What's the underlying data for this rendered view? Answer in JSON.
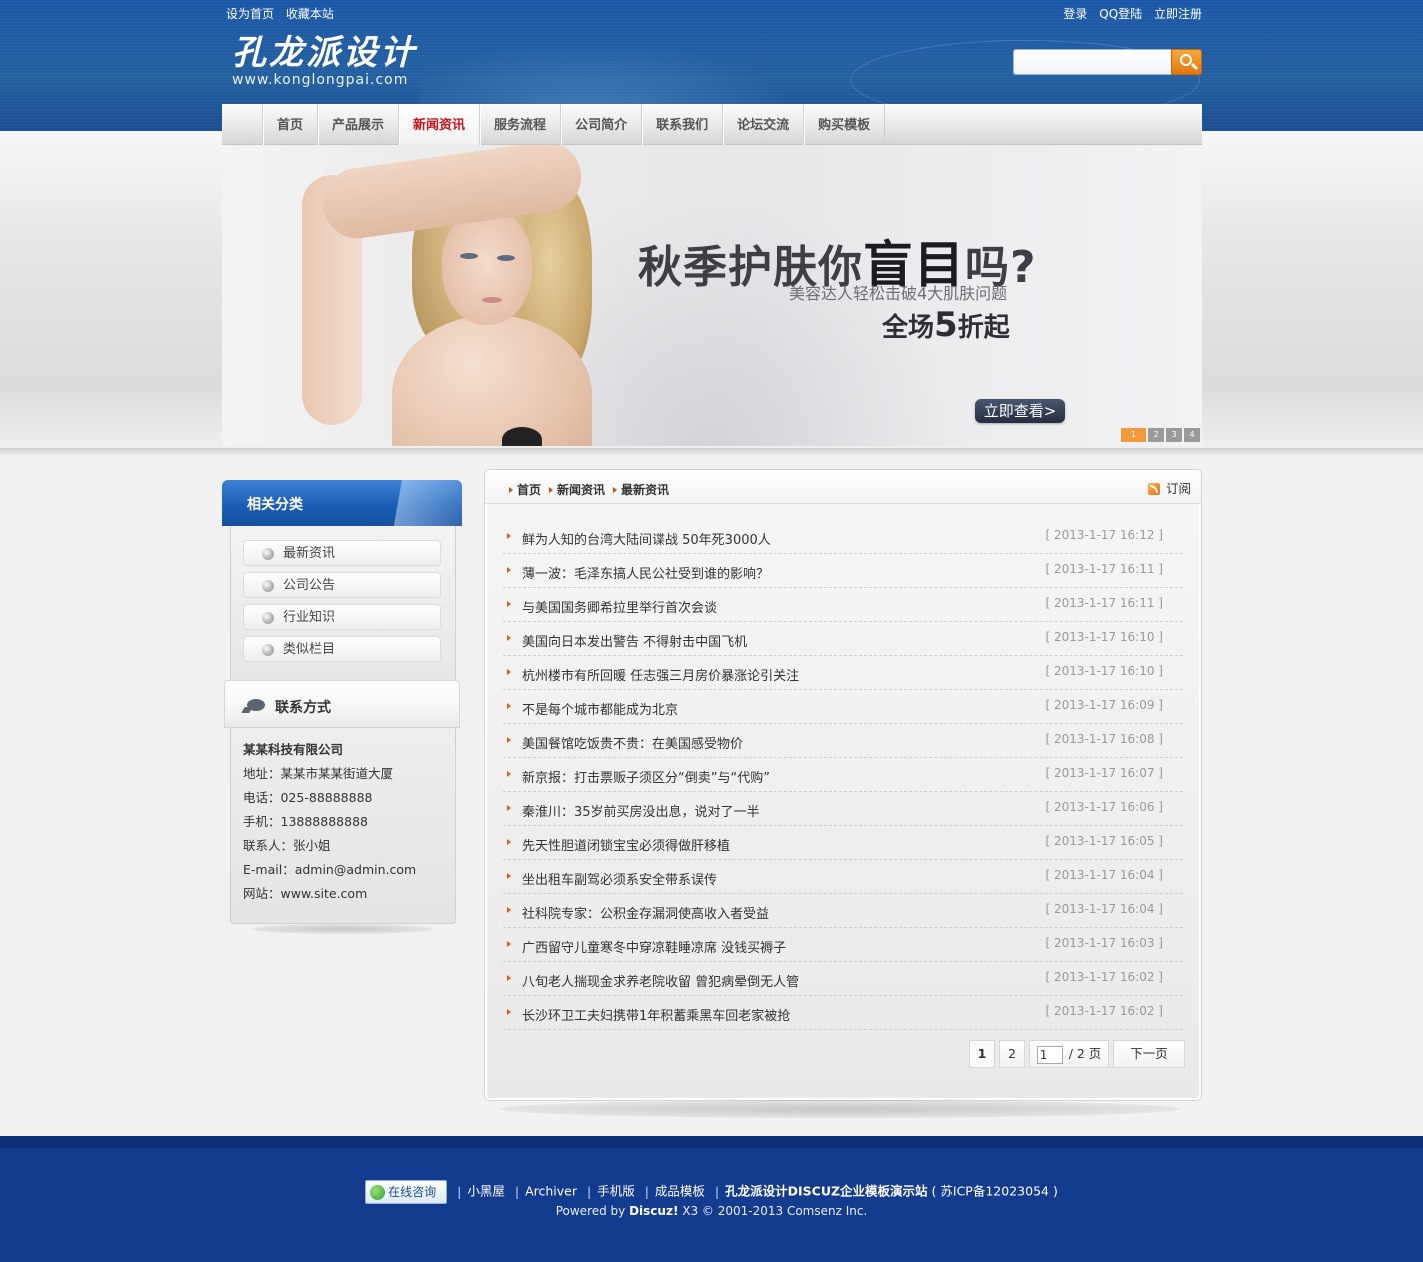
{
  "topbar": {
    "left": [
      "设为首页",
      "收藏本站"
    ],
    "right": [
      "登录",
      "QQ登陆",
      "立即注册"
    ]
  },
  "logo": {
    "title": "孔龙派设计",
    "url": "www.konglongpai.com"
  },
  "search": {
    "placeholder": "",
    "value": ""
  },
  "nav": {
    "items": [
      "首页",
      "产品展示",
      "新闻资讯",
      "服务流程",
      "公司简介",
      "联系我们",
      "论坛交流",
      "购买模板"
    ],
    "active": "新闻资讯"
  },
  "banner": {
    "headline_a": "秋季护肤你",
    "headline_b": "盲目",
    "headline_c": "吗?",
    "sub": "美容达人轻松击破4大肌肤问题",
    "promo_a": "全场",
    "promo_b": "5",
    "promo_c": "折起",
    "button": "立即查看>",
    "dots": [
      "1",
      "2",
      "3",
      "4"
    ],
    "active_dot": 1
  },
  "sidebar": {
    "category_title": "相关分类",
    "categories": [
      "最新资讯",
      "公司公告",
      "行业知识",
      "类似栏目"
    ],
    "contact_title": "联系方式",
    "contact": {
      "company": "某某科技有限公司",
      "address": "地址：某某市某某街道大厦",
      "phone": "电话：025-88888888",
      "mobile": "手机：13888888888",
      "person": "联系人：张小姐",
      "email": "E-mail：admin@admin.com",
      "site": "网站：www.site.com"
    }
  },
  "breadcrumb": [
    "首页",
    "新闻资讯",
    "最新资讯"
  ],
  "rss_label": "订阅",
  "news": [
    {
      "title": "鲜为人知的台湾大陆间谍战 50年死3000人",
      "date": "[ 2013-1-17 16:12 ]"
    },
    {
      "title": "薄一波：毛泽东搞人民公社受到谁的影响？",
      "date": "[ 2013-1-17 16:11 ]"
    },
    {
      "title": "与美国国务卿希拉里举行首次会谈",
      "date": "[ 2013-1-17 16:11 ]"
    },
    {
      "title": "美国向日本发出警告 不得射击中国飞机",
      "date": "[ 2013-1-17 16:10 ]"
    },
    {
      "title": "杭州楼市有所回暖 任志强三月房价暴涨论引关注",
      "date": "[ 2013-1-17 16:10 ]"
    },
    {
      "title": "不是每个城市都能成为北京",
      "date": "[ 2013-1-17 16:09 ]"
    },
    {
      "title": "美国餐馆吃饭贵不贵：在美国感受物价",
      "date": "[ 2013-1-17 16:08 ]"
    },
    {
      "title": "新京报：打击票贩子须区分“倒卖”与“代购”",
      "date": "[ 2013-1-17 16:07 ]"
    },
    {
      "title": "秦淮川：35岁前买房没出息，说对了一半",
      "date": "[ 2013-1-17 16:06 ]"
    },
    {
      "title": "先天性胆道闭锁宝宝必须得做肝移植",
      "date": "[ 2013-1-17 16:05 ]"
    },
    {
      "title": "坐出租车副驾必须系安全带系误传",
      "date": "[ 2013-1-17 16:04 ]"
    },
    {
      "title": "社科院专家：公积金存漏洞使高收入者受益",
      "date": "[ 2013-1-17 16:04 ]"
    },
    {
      "title": "广西留守儿童寒冬中穿凉鞋睡凉席 没钱买褥子",
      "date": "[ 2013-1-17 16:03 ]"
    },
    {
      "title": "八旬老人揣现金求养老院收留 曾犯病晕倒无人管",
      "date": "[ 2013-1-17 16:02 ]"
    },
    {
      "title": "长沙环卫工夫妇携带1年积蓄乘黑车回老家被抢",
      "date": "[ 2013-1-17 16:02 ]"
    }
  ],
  "pager": {
    "page1": "1",
    "page2": "2",
    "input": "1",
    "total": "/ 2 页",
    "next": "下一页"
  },
  "footer": {
    "chat": "在线咨询",
    "links": [
      "小黑屋",
      "Archiver",
      "手机版",
      "成品模板"
    ],
    "site_name": "孔龙派设计DISCUZ企业模板演示站",
    "icp": "( 苏ICP备12023054 )",
    "powered_prefix": "Powered by ",
    "powered_brand": "Discuz!",
    "powered_suffix": " X3 © 2001-2013 Comsenz Inc."
  },
  "colors": {
    "nav_active": "#c8141a",
    "header_blue": "#1d58a8",
    "footer_blue": "#133b8e",
    "accent_orange": "#f59a3a"
  }
}
